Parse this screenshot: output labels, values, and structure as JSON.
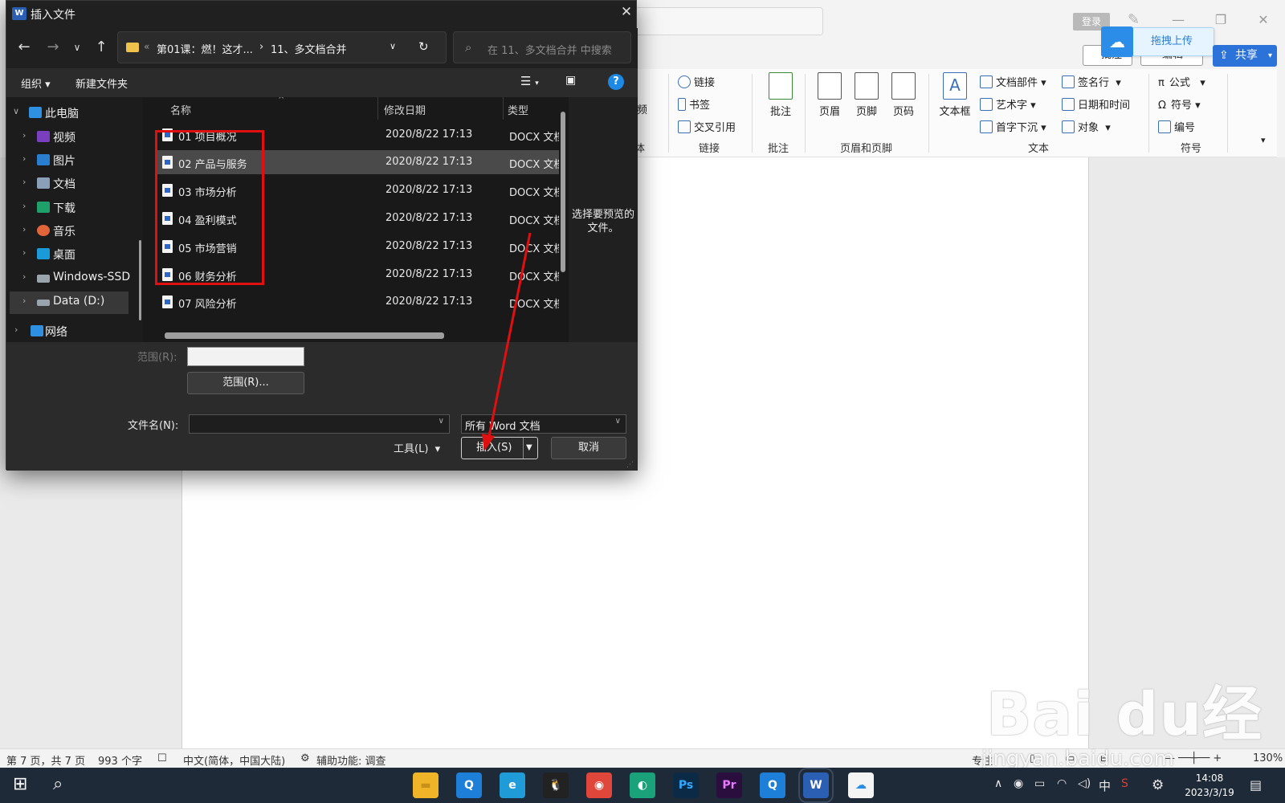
{
  "word": {
    "login": "登录",
    "upload": "拖拽上传",
    "annot_btn": "批注",
    "edit_btn": "编辑",
    "share": "共享",
    "ribbon": {
      "video": "视频",
      "partial_left_group": "体",
      "link_group": {
        "items": [
          "链接",
          "书签",
          "交叉引用"
        ],
        "name": "链接"
      },
      "comment": {
        "label": "批注",
        "group": "批注"
      },
      "header_footer": {
        "items": [
          "页眉",
          "页脚",
          "页码"
        ],
        "group": "页眉和页脚"
      },
      "text": {
        "textbox": "文本框",
        "items": [
          "文档部件",
          "艺术字",
          "首字下沉"
        ],
        "items2": [
          "签名行",
          "日期和时间",
          "对象"
        ],
        "group": "文本"
      },
      "symbols": {
        "items": [
          "公式",
          "符号",
          "编号"
        ],
        "group": "符号"
      }
    },
    "status": {
      "page": "第 7 页，共 7 页",
      "words": "993 个字",
      "lang": "中文(简体，中国大陆)",
      "access": "辅助功能: 调查",
      "focus": "专注",
      "zoom": "130%"
    }
  },
  "dialog": {
    "title": "插入文件",
    "address": {
      "root": "第01课：燃！这才...",
      "current": "11、多文档合并"
    },
    "search_placeholder": "在 11、多文档合并 中搜索",
    "cmd": {
      "organize": "组织",
      "new_folder": "新建文件夹"
    },
    "nav": [
      {
        "label": "此电脑",
        "color": "#2f8fe0"
      },
      {
        "label": "视频",
        "color": "#7a3fbf"
      },
      {
        "label": "图片",
        "color": "#2a7ecf"
      },
      {
        "label": "文档",
        "color": "#8aa0b8"
      },
      {
        "label": "下载",
        "color": "#1f9f6a"
      },
      {
        "label": "音乐",
        "color": "#e0663a"
      },
      {
        "label": "桌面",
        "color": "#1a9ad8"
      },
      {
        "label": "Windows-SSD",
        "color": "#9aa4ad"
      },
      {
        "label": "Data (D:)",
        "color": "#9aa4ad"
      },
      {
        "label": "网络",
        "color": "#2f8fe0"
      }
    ],
    "columns": {
      "name": "名称",
      "date": "修改日期",
      "type": "类型"
    },
    "files": [
      {
        "name": "01 项目概况",
        "date": "2020/8/22 17:13",
        "type": "DOCX 文档"
      },
      {
        "name": "02 产品与服务",
        "date": "2020/8/22 17:13",
        "type": "DOCX 文档"
      },
      {
        "name": "03 市场分析",
        "date": "2020/8/22 17:13",
        "type": "DOCX 文档"
      },
      {
        "name": "04 盈利模式",
        "date": "2020/8/22 17:13",
        "type": "DOCX 文档"
      },
      {
        "name": "05 市场营销",
        "date": "2020/8/22 17:13",
        "type": "DOCX 文档"
      },
      {
        "name": "06 财务分析",
        "date": "2020/8/22 17:13",
        "type": "DOCX 文档"
      },
      {
        "name": "07 风险分析",
        "date": "2020/8/22 17:13",
        "type": "DOCX 文档"
      }
    ],
    "preview_text": "选择要预览的文件。",
    "range_label": "范围(R):",
    "range_btn": "范围(R)...",
    "filename_label": "文件名(N):",
    "filename_value": "",
    "filetype": "所有 Word 文档",
    "tools": "工具(L)",
    "insert": "插入(S)",
    "cancel": "取消"
  },
  "taskbar": {
    "apps": [
      {
        "name": "file-explorer",
        "color": "#f0b429",
        "glyph": "▬"
      },
      {
        "name": "browser-q",
        "color": "#1d7fd8",
        "glyph": "Q"
      },
      {
        "name": "edge",
        "color": "#1f9bd8",
        "glyph": "e"
      },
      {
        "name": "qq",
        "color": "#222",
        "glyph": "🐧"
      },
      {
        "name": "chrome",
        "color": "#e0463a",
        "glyph": "◉"
      },
      {
        "name": "edge-2",
        "color": "#1aa37a",
        "glyph": "◐"
      },
      {
        "name": "photoshop",
        "color": "#0b2a46",
        "glyph": "Ps"
      },
      {
        "name": "premiere",
        "color": "#2a0f3e",
        "glyph": "Pr"
      },
      {
        "name": "browser-q-2",
        "color": "#1d7fd8",
        "glyph": "Q"
      },
      {
        "name": "word",
        "color": "#2b5fb3",
        "glyph": "W"
      },
      {
        "name": "baidu-netdisk",
        "color": "#f4f4f4",
        "glyph": "☁"
      }
    ],
    "ime": "中",
    "time": "14:08",
    "date": "2023/3/19"
  },
  "watermark": {
    "main": "Bai du经验",
    "sub": "jingyan.baidu.com"
  }
}
